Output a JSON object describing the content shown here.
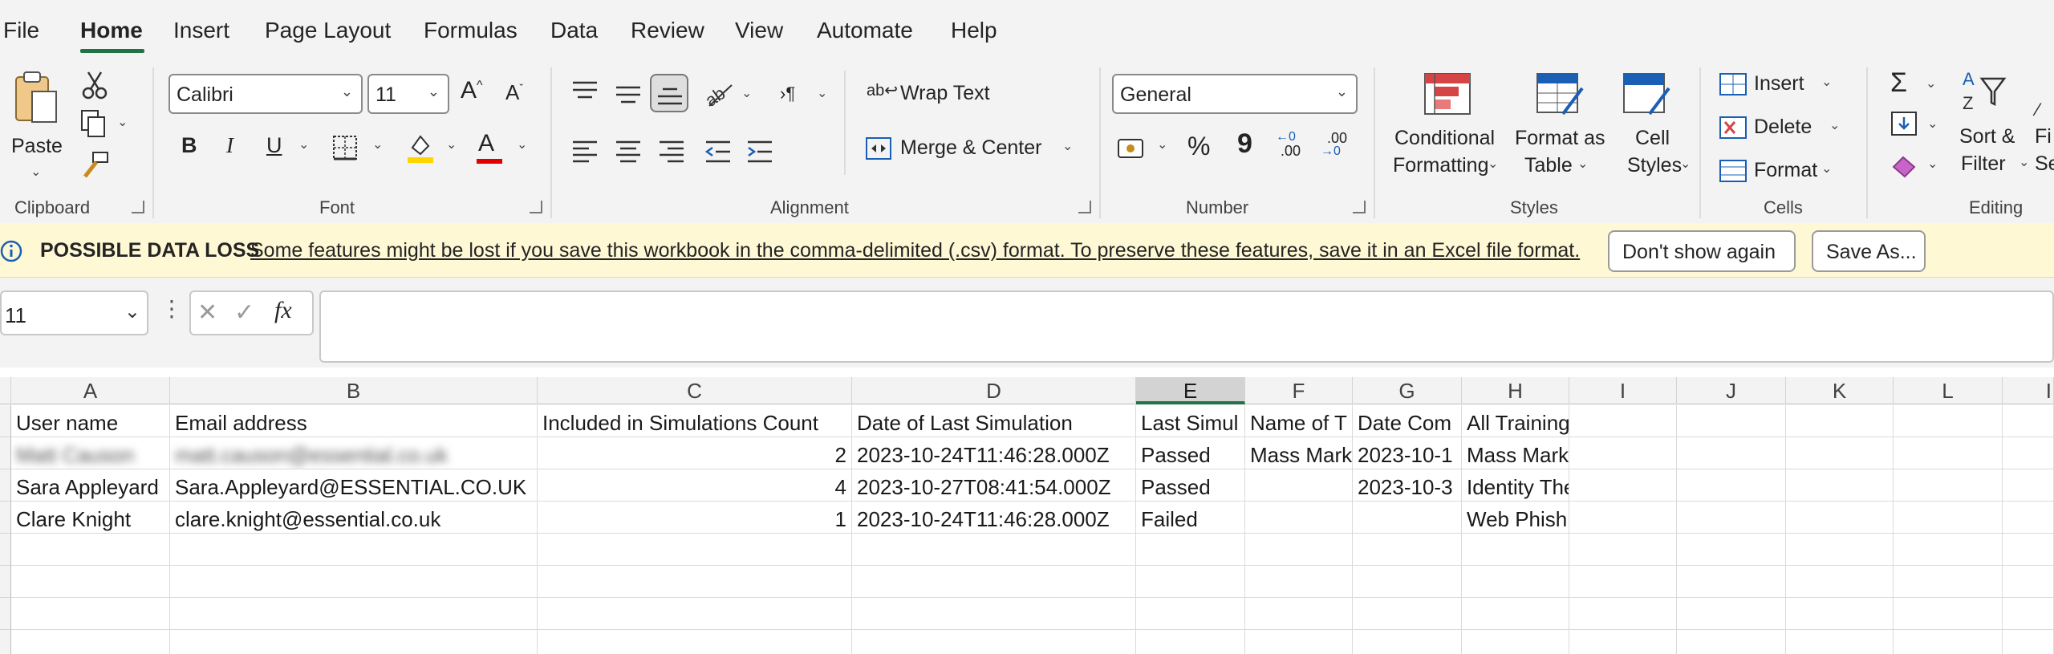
{
  "menu": {
    "tabs": [
      "File",
      "Home",
      "Insert",
      "Page Layout",
      "Formulas",
      "Data",
      "Review",
      "View",
      "Automate",
      "Help"
    ],
    "active": "Home"
  },
  "ribbon": {
    "clipboard": {
      "paste_label": "Paste",
      "group_label": "Clipboard"
    },
    "font": {
      "family": "Calibri",
      "size": "11",
      "grow_label": "A",
      "shrink_label": "A",
      "bold": "B",
      "italic": "I",
      "underline": "U",
      "font_color_glyph": "A",
      "group_label": "Font",
      "highlight_color": "#ffd500",
      "font_color": "#e00000"
    },
    "alignment": {
      "wrap_text": "Wrap Text",
      "merge_center": "Merge & Center",
      "group_label": "Alignment"
    },
    "number": {
      "format": "General",
      "percent": "%",
      "comma": "9",
      "inc_decimal": ".00",
      "dec_decimal": ".00",
      "group_label": "Number"
    },
    "styles": {
      "conditional_1": "Conditional",
      "conditional_2": "Formatting",
      "format_table_1": "Format as",
      "format_table_2": "Table",
      "cell_styles_1": "Cell",
      "cell_styles_2": "Styles",
      "group_label": "Styles"
    },
    "cells": {
      "insert": "Insert",
      "delete": "Delete",
      "format": "Format",
      "group_label": "Cells"
    },
    "editing": {
      "sum_glyph": "Σ",
      "sort_1": "Sort &",
      "sort_2": "Filter",
      "find_1": "Fi",
      "find_2": "Se",
      "group_label": "Editing"
    }
  },
  "message_bar": {
    "title": "POSSIBLE DATA LOSS",
    "text": "Some features might be lost if you save this workbook in the comma-delimited (.csv) format. To preserve these features, save it in an Excel file format.",
    "dont_show": "Don't show again",
    "save_as": "Save As..."
  },
  "formula_bar": {
    "name_box": "11",
    "fx": "fx",
    "value": ""
  },
  "grid": {
    "columns": [
      "A",
      "B",
      "C",
      "D",
      "E",
      "F",
      "G",
      "H",
      "I",
      "J",
      "K",
      "L",
      "I"
    ],
    "selected_column": "E",
    "rows": [
      [
        "User name",
        "Email address",
        "Included in Simulations Count",
        "Date of Last Simulation",
        "Last Simul",
        "Name of T",
        "Date Com",
        "All Trainings"
      ],
      [
        "Matt Causon",
        "matt.causon@essential.co.uk",
        "2",
        "2023-10-24T11:46:28.000Z",
        "Passed",
        "Mass Mark",
        "2023-10-1",
        "Mass Market Phishing - Amazon Gift Card"
      ],
      [
        "Sara Appleyard",
        "Sara.Appleyard@ESSENTIAL.CO.UK",
        "4",
        "2023-10-27T08:41:54.000Z",
        "Passed",
        "",
        "2023-10-3",
        "Identity Theft,Malware,Ransomware,"
      ],
      [
        "Clare Knight",
        "clare.knight@essential.co.uk",
        "1",
        "2023-10-24T11:46:28.000Z",
        "Failed",
        "",
        "",
        "Web Phishing"
      ]
    ]
  },
  "colors": {
    "accent": "#217346",
    "message_bar": "#fff8d5"
  }
}
